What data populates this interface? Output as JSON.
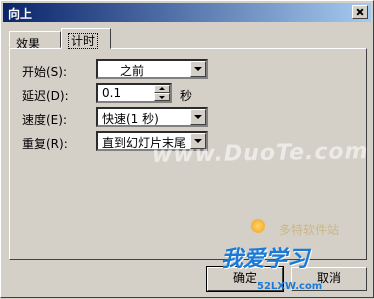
{
  "window": {
    "title": "向上"
  },
  "tabs": [
    {
      "label": "效果",
      "active": false
    },
    {
      "label": "计时",
      "active": true
    }
  ],
  "form": {
    "start": {
      "label": "开始(S):",
      "value": "之前"
    },
    "delay": {
      "label": "延迟(D):",
      "value": "0.1",
      "unit": "秒"
    },
    "speed": {
      "label": "速度(E):",
      "value": "快速(1 秒)"
    },
    "repeat": {
      "label": "重复(R):",
      "value": "直到幻灯片末尾"
    }
  },
  "buttons": {
    "ok": "确定",
    "cancel": "取消"
  },
  "watermark": {
    "text": "www.DuoTe.com",
    "logo_main": "我爱学习",
    "logo_small": "多特软件站",
    "logo_url": "52LXW.com"
  },
  "colors": {
    "face": "#d4d0c8",
    "titlebar_start": "#0a246a",
    "titlebar_end": "#a6caf0",
    "logo_blue": "#1a7ad8"
  }
}
